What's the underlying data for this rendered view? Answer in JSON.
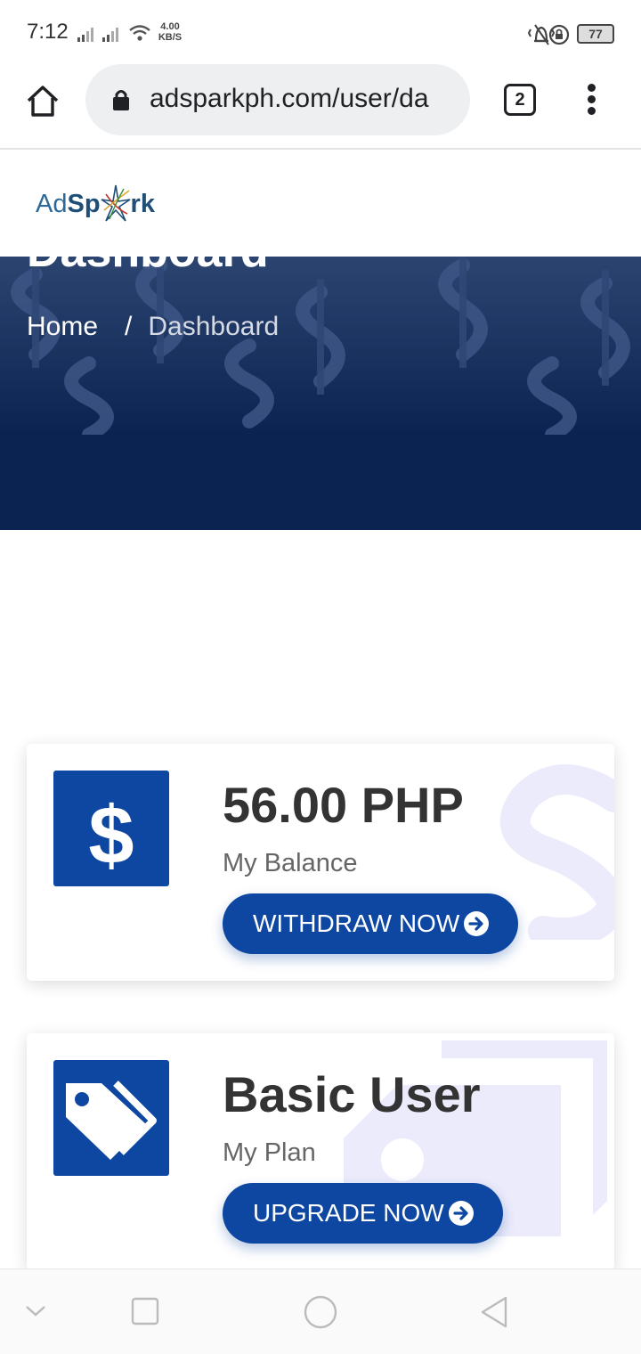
{
  "status_bar": {
    "time": "7:12",
    "net_speed_value": "4.00",
    "net_speed_unit": "KB/S",
    "battery": "77"
  },
  "browser": {
    "url": "adsparkph.com/user/da",
    "tab_count": "2"
  },
  "site": {
    "logo_ad": "Ad",
    "logo_sp": "Sp",
    "logo_rk": "rk"
  },
  "hero": {
    "title": "Dashboard",
    "breadcrumb_home": "Home",
    "breadcrumb_sep": "/",
    "breadcrumb_current": "Dashboard"
  },
  "cards": [
    {
      "value": "56.00 PHP",
      "label": "My Balance",
      "button": "WITHDRAW NOW",
      "icon": "dollar-icon"
    },
    {
      "value": "Basic User",
      "label": "My Plan",
      "button": "UPGRADE NOW",
      "icon": "tags-icon"
    }
  ],
  "colors": {
    "primary": "#0d47a1",
    "hero_bg": "#0a2350",
    "watermark": "#ecebfb"
  }
}
